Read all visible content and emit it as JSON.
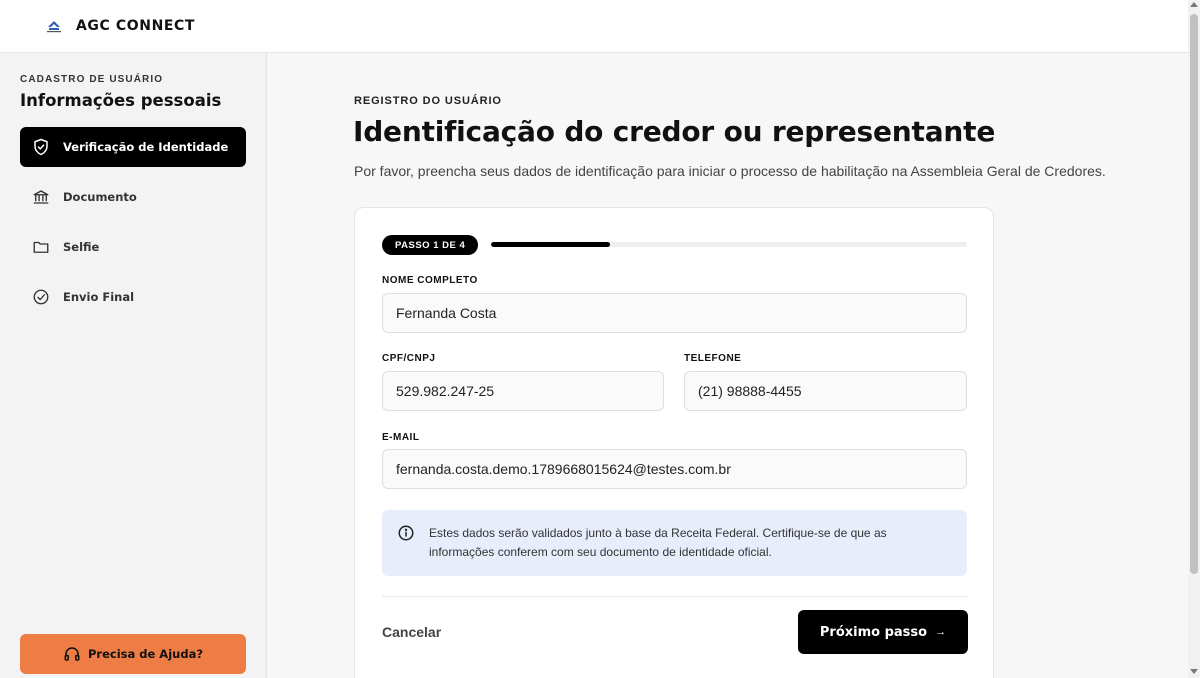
{
  "app": {
    "brand": "AGC CONNECT",
    "logo_icon": "agc-logo-icon",
    "accent_color": "#ee7c45",
    "primary_color": "#000000"
  },
  "sidebar": {
    "eyebrow": "CADASTRO DE USUÁRIO",
    "title": "Informações pessoais",
    "items": [
      {
        "label": "Verificação de Identidade",
        "icon": "shield-check-icon",
        "active": true
      },
      {
        "label": "Documento",
        "icon": "bank-icon",
        "active": false
      },
      {
        "label": "Selfie",
        "icon": "folder-icon",
        "active": false
      },
      {
        "label": "Envio Final",
        "icon": "check-circle-icon",
        "active": false
      }
    ],
    "help_label": "Precisa de Ajuda?",
    "help_icon": "headset-icon"
  },
  "main": {
    "eyebrow": "REGISTRO DO USUÁRIO",
    "title": "Identificação do credor ou representante",
    "subtitle": "Por favor, preencha seus dados de identificação para iniciar o processo de habilitação na Assembleia Geral de Credores."
  },
  "form": {
    "step_badge": "PASSO 1 DE 4",
    "progress": 0.25,
    "fields": {
      "nome": {
        "label": "NOME COMPLETO",
        "value": "Fernanda Costa"
      },
      "cpf": {
        "label": "CPF/CNPJ",
        "value": "529.982.247-25"
      },
      "telefone": {
        "label": "TELEFONE",
        "value": "(21) 98888-4455"
      },
      "email": {
        "label": "E-MAIL",
        "value": "fernanda.costa.demo.1789668015624@testes.com.br"
      }
    },
    "info_icon": "info-icon",
    "info_text": "Estes dados serão validados junto à base da Receita Federal. Certifique-se de que as informações conferem com seu documento de identidade oficial.",
    "cancel_label": "Cancelar",
    "next_label": "Próximo passo",
    "next_icon": "arrow-right-icon"
  }
}
